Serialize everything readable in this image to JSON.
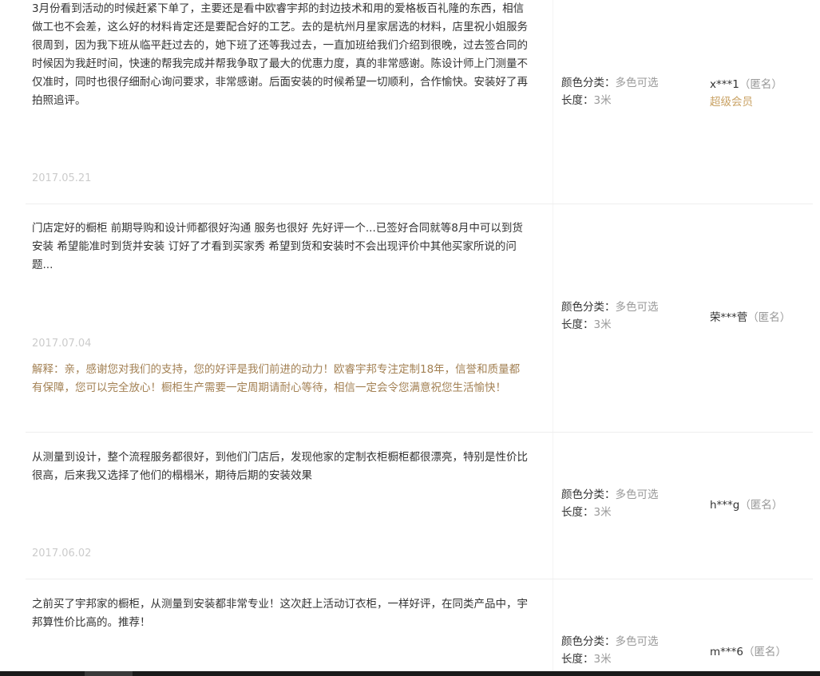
{
  "reviews": [
    {
      "text": "3月份看到活动的时候赶紧下单了，主要还是看中欧睿宇邦的封边技术和用的爱格板百礼隆的东西，相信做工也不会差，这么好的材料肯定还是要配合好的工艺。去的是杭州月星家居选的材料，店里祝小姐服务很周到，因为我下班从临平赶过去的，她下班了还等我过去，一直加班给我们介绍到很晚，过去签合同的时候因为我赶时间，快速的帮我完成并帮我争取了最大的优惠力度，真的非常感谢。陈设计师上门测量不仅准时，同时也很仔细耐心询问要求，非常感谢。后面安装的时候希望一切顺利，合作愉快。安装好了再拍照追评。",
      "date": "2017.05.21",
      "reply": "",
      "sku": {
        "color_label": "颜色分类：",
        "color_value": "多色可选",
        "length_label": "长度：",
        "length_value": "3米"
      },
      "user": {
        "name": "x***1",
        "anon": "（匿名）",
        "vip": "超级会员"
      }
    },
    {
      "text": "门店定好的橱柜 前期导购和设计师都很好沟通 服务也很好 先好评一个...已签好合同就等8月中可以到货安装 希望能准时到货并安装 订好了才看到买家秀 希望到货和安装时不会出现评价中其他买家所说的问题...",
      "date": "2017.07.04",
      "reply": "解释：亲，感谢您对我们的支持，您的好评是我们前进的动力！欧睿宇邦专注定制18年，信誉和质量都有保障，您可以完全放心！橱柜生产需要一定周期请耐心等待，相信一定会令您满意祝您生活愉快！",
      "sku": {
        "color_label": "颜色分类：",
        "color_value": "多色可选",
        "length_label": "长度：",
        "length_value": "3米"
      },
      "user": {
        "name": "荣***菅",
        "anon": "（匿名）",
        "vip": ""
      }
    },
    {
      "text": "从测量到设计，整个流程服务都很好，到他们门店后，发现他家的定制衣柜橱柜都很漂亮，特别是性价比很高，后来我又选择了他们的榻榻米，期待后期的安装效果",
      "date": "2017.06.02",
      "reply": "",
      "sku": {
        "color_label": "颜色分类：",
        "color_value": "多色可选",
        "length_label": "长度：",
        "length_value": "3米"
      },
      "user": {
        "name": "h***g",
        "anon": "（匿名）",
        "vip": ""
      }
    },
    {
      "text": "之前买了宇邦家的橱柜，从测量到安装都非常专业！这次赶上活动订衣柜，一样好评，在同类产品中，宇邦算性价比高的。推荐！",
      "date": "",
      "reply": "",
      "sku": {
        "color_label": "颜色分类：",
        "color_value": "多色可选",
        "length_label": "长度：",
        "length_value": "3米"
      },
      "user": {
        "name": "m***6",
        "anon": "（匿名）",
        "vip": ""
      }
    }
  ]
}
